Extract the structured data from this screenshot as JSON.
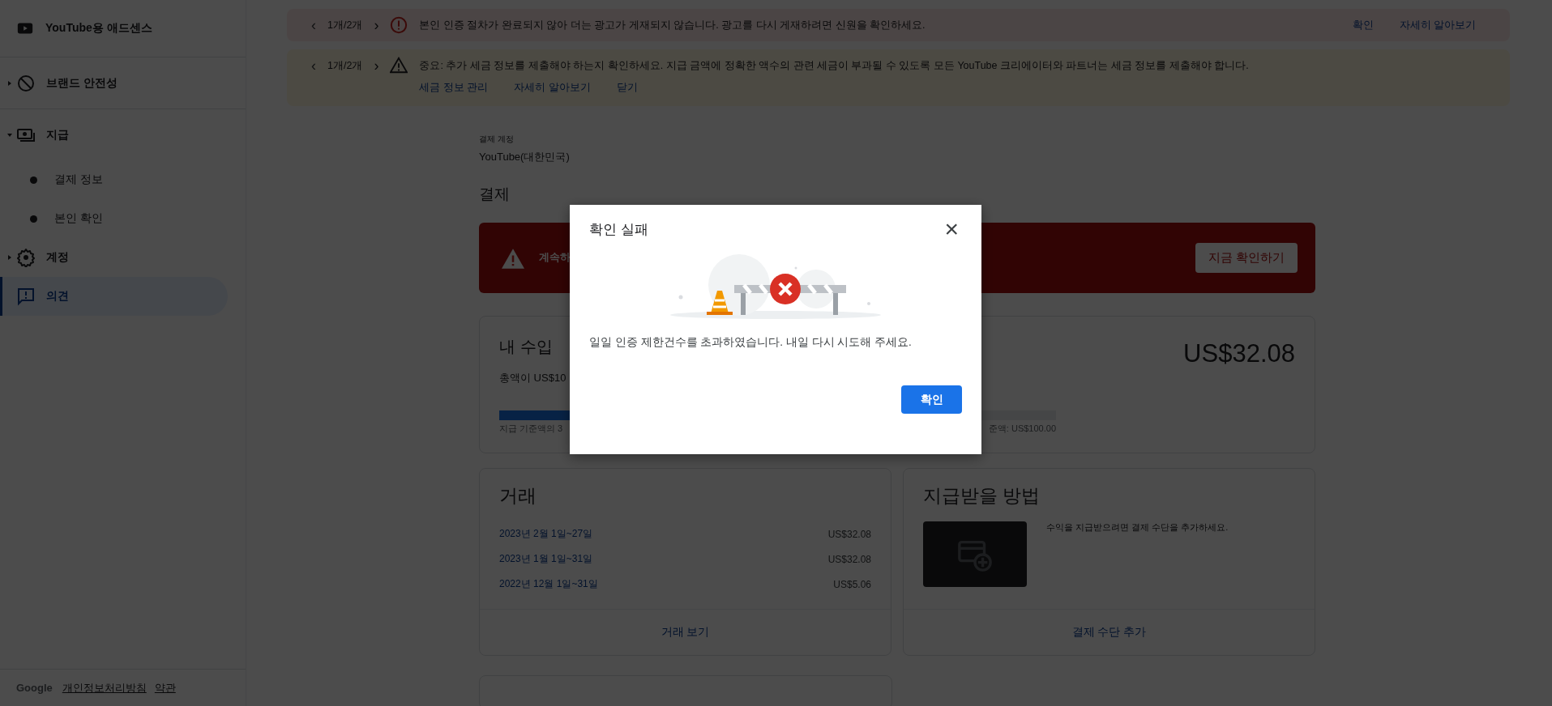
{
  "sidebar": {
    "app_title": "YouTube용 애드센스",
    "items": [
      {
        "kind": "group",
        "label": "브랜드 안전성",
        "expanded": false,
        "selected": false
      },
      {
        "kind": "group",
        "label": "지급",
        "expanded": true,
        "selected": false,
        "children": [
          {
            "label": "결제 정보",
            "selected": false
          },
          {
            "label": "본인 확인",
            "selected": false
          }
        ]
      },
      {
        "kind": "group",
        "label": "계정",
        "expanded": false,
        "selected": false
      },
      {
        "kind": "link",
        "label": "의견",
        "expanded": false,
        "selected": true
      }
    ],
    "footer": {
      "brand": "Google",
      "links": [
        "개인정보처리방침",
        "약관"
      ]
    }
  },
  "banners": [
    {
      "kind": "error",
      "prev": "‹",
      "pager": "1개/2개",
      "next": "›",
      "message": "본인 인증 절차가 완료되지 않아 더는 광고가 게재되지 않습니다. 광고를 다시 게재하려면 신원을 확인하세요.",
      "actions": [
        "확인",
        "자세히 알아보기"
      ]
    },
    {
      "kind": "warning",
      "prev": "‹",
      "pager": "1개/2개",
      "next": "›",
      "message": "중요: 추가 세금 정보를 제출해야 하는지 확인하세요. 지급 금액에 정확한 액수의 관련 세금이 부과될 수 있도록 모든 YouTube 크리에이터와 파트너는 세금 정보를 제출해야 합니다.",
      "actions": [
        "세금 정보 관리",
        "자세히 알아보기",
        "닫기"
      ]
    }
  ],
  "account": {
    "label": "결제 계정",
    "value": "YouTube(대한민국)"
  },
  "section_title": "결제",
  "alert": {
    "text": "계속하",
    "button": "지금 확인하기"
  },
  "earnings": {
    "title": "내 수입",
    "amount": "US$32.08",
    "note": "총액이 US$10",
    "level": 0.32,
    "caption_left": "지급 기준액의 3",
    "caption_right": "준액: US$100.00"
  },
  "transactions": {
    "title": "거래",
    "rows": [
      {
        "period": "2023년 2월 1일~27일",
        "amount": "US$32.08"
      },
      {
        "period": "2023년 1월 1일~31일",
        "amount": "US$32.08"
      },
      {
        "period": "2022년 12월 1일~31일",
        "amount": "US$5.06"
      }
    ],
    "link": "거래 보기"
  },
  "payment": {
    "title": "지급받을 방법",
    "text": "수익을 지급받으려면 결제 수단을 추가하세요.",
    "link": "결제 수단 추가"
  },
  "dialog": {
    "title": "확인 실패",
    "close": "×",
    "message": "일일 인증 제한건수를 초과하였습니다. 내일 다시 시도해 주세요.",
    "button": "확인"
  }
}
